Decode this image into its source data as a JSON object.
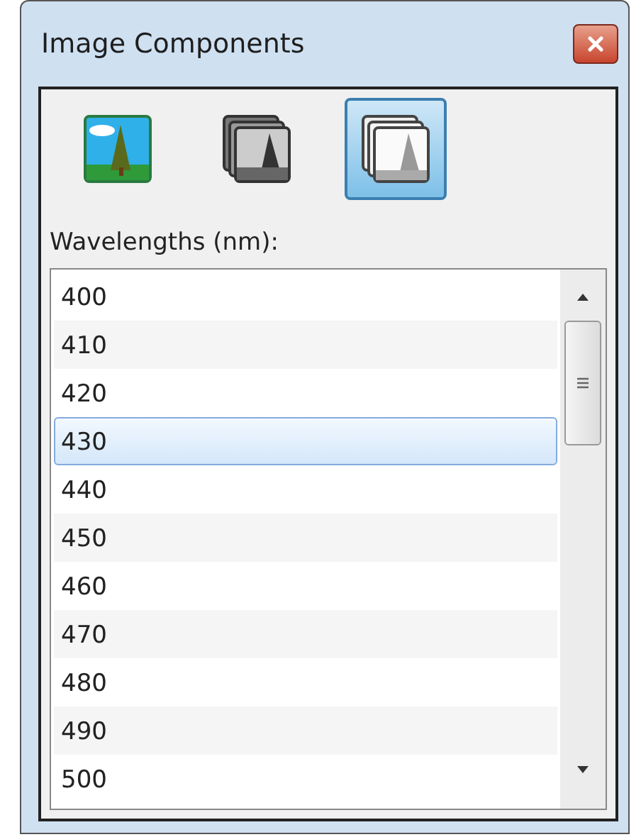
{
  "window": {
    "title": "Image Components"
  },
  "view_modes": [
    {
      "kind": "color",
      "selected": false
    },
    {
      "kind": "grayscale",
      "selected": false
    },
    {
      "kind": "spectral",
      "selected": true
    }
  ],
  "wavelengths_label": "Wavelengths (nm):",
  "wavelengths": [
    {
      "label": "400",
      "selected": false
    },
    {
      "label": "410",
      "selected": false
    },
    {
      "label": "420",
      "selected": false
    },
    {
      "label": "430",
      "selected": true
    },
    {
      "label": "440",
      "selected": false
    },
    {
      "label": "450",
      "selected": false
    },
    {
      "label": "460",
      "selected": false
    },
    {
      "label": "470",
      "selected": false
    },
    {
      "label": "480",
      "selected": false
    },
    {
      "label": "490",
      "selected": false
    },
    {
      "label": "500",
      "selected": false
    }
  ]
}
